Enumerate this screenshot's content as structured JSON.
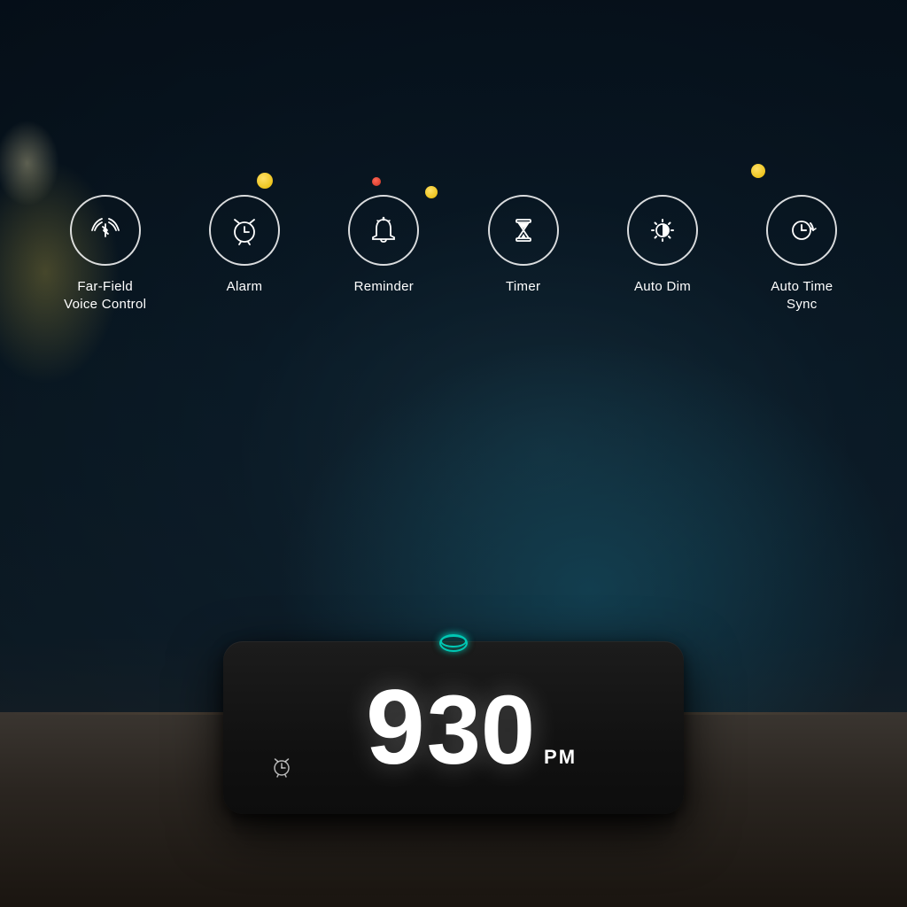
{
  "background": {
    "description": "Bedroom scene at night with blurred background"
  },
  "features": [
    {
      "id": "far-field-voice",
      "label": "Far-Field\nVoice Control",
      "label_line1": "Far-Field",
      "label_line2": "Voice Control",
      "icon": "wifi-signal-icon"
    },
    {
      "id": "alarm",
      "label": "Alarm",
      "label_line1": "Alarm",
      "label_line2": "",
      "icon": "alarm-clock-icon"
    },
    {
      "id": "reminder",
      "label": "Reminder",
      "label_line1": "Reminder",
      "label_line2": "",
      "icon": "bell-icon"
    },
    {
      "id": "timer",
      "label": "Timer",
      "label_line1": "Timer",
      "label_line2": "",
      "icon": "hourglass-icon"
    },
    {
      "id": "auto-dim",
      "label": "Auto Dim",
      "label_line1": "Auto Dim",
      "label_line2": "",
      "icon": "brightness-icon"
    },
    {
      "id": "auto-time-sync",
      "label": "Auto Time\nSync",
      "label_line1": "Auto Time",
      "label_line2": "Sync",
      "icon": "clock-sync-icon"
    }
  ],
  "clock": {
    "time": "9 30",
    "hour": "9",
    "minutes": "30",
    "period": "PM",
    "alarm_set": true
  }
}
